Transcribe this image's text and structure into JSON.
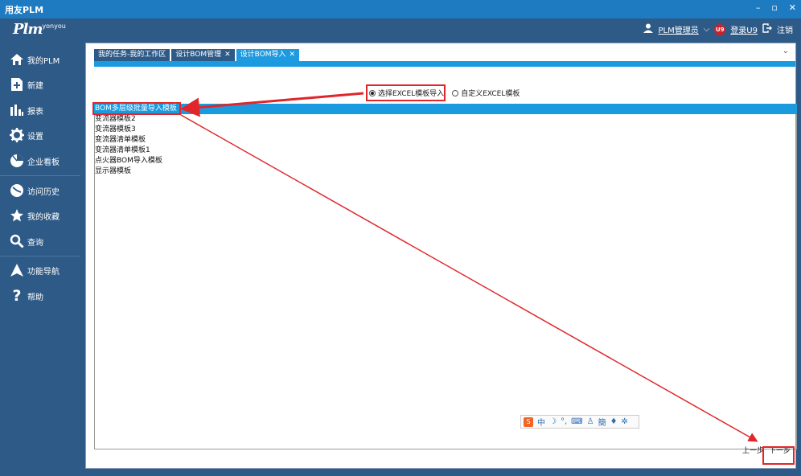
{
  "window": {
    "title": "用友PLM",
    "controls": [
      "–",
      "▫",
      "✕"
    ]
  },
  "header": {
    "logo_text": "Plm",
    "logo_sup": "yonyou",
    "user_label": "PLM管理员",
    "u9_badge": "U9",
    "login_label": "登录U9",
    "logout_label": "注销"
  },
  "sidebar": {
    "items": [
      {
        "label": "我的PLM",
        "icon": "home-icon"
      },
      {
        "label": "新建",
        "icon": "new-document-icon"
      },
      {
        "label": "报表",
        "icon": "bar-chart-icon"
      },
      {
        "label": "设置",
        "icon": "gear-icon"
      },
      {
        "label": "企业看板",
        "icon": "pie-chart-icon"
      },
      {
        "label": "访问历史",
        "icon": "clock-icon"
      },
      {
        "label": "我的收藏",
        "icon": "star-icon"
      },
      {
        "label": "查询",
        "icon": "search-icon"
      },
      {
        "label": "功能导航",
        "icon": "navigation-icon"
      },
      {
        "label": "帮助",
        "icon": "help-icon"
      }
    ]
  },
  "tabs": [
    {
      "label": "我的任务-我的工作区",
      "closable": false,
      "active": false
    },
    {
      "label": "设计BOM管理",
      "closable": true,
      "active": false
    },
    {
      "label": "设计BOM导入",
      "closable": true,
      "active": true
    }
  ],
  "import_options": {
    "selected": "选择EXCEL模板导入",
    "other": "自定义EXCEL模板"
  },
  "templates": [
    "BOM多层级批量导入模板",
    "变流器模板2",
    "变流器模板3",
    "变流器清单模板",
    "变流器清单模板1",
    "点火器BOM导入模板",
    "显示器模板"
  ],
  "ime": {
    "logo": "S",
    "lang": "中"
  },
  "footer": {
    "prev_label": "上一步",
    "next_label": "下一步"
  },
  "colors": {
    "accent": "#1a9be0",
    "sidebar": "#2e5a87",
    "highlight": "#e0262a"
  }
}
